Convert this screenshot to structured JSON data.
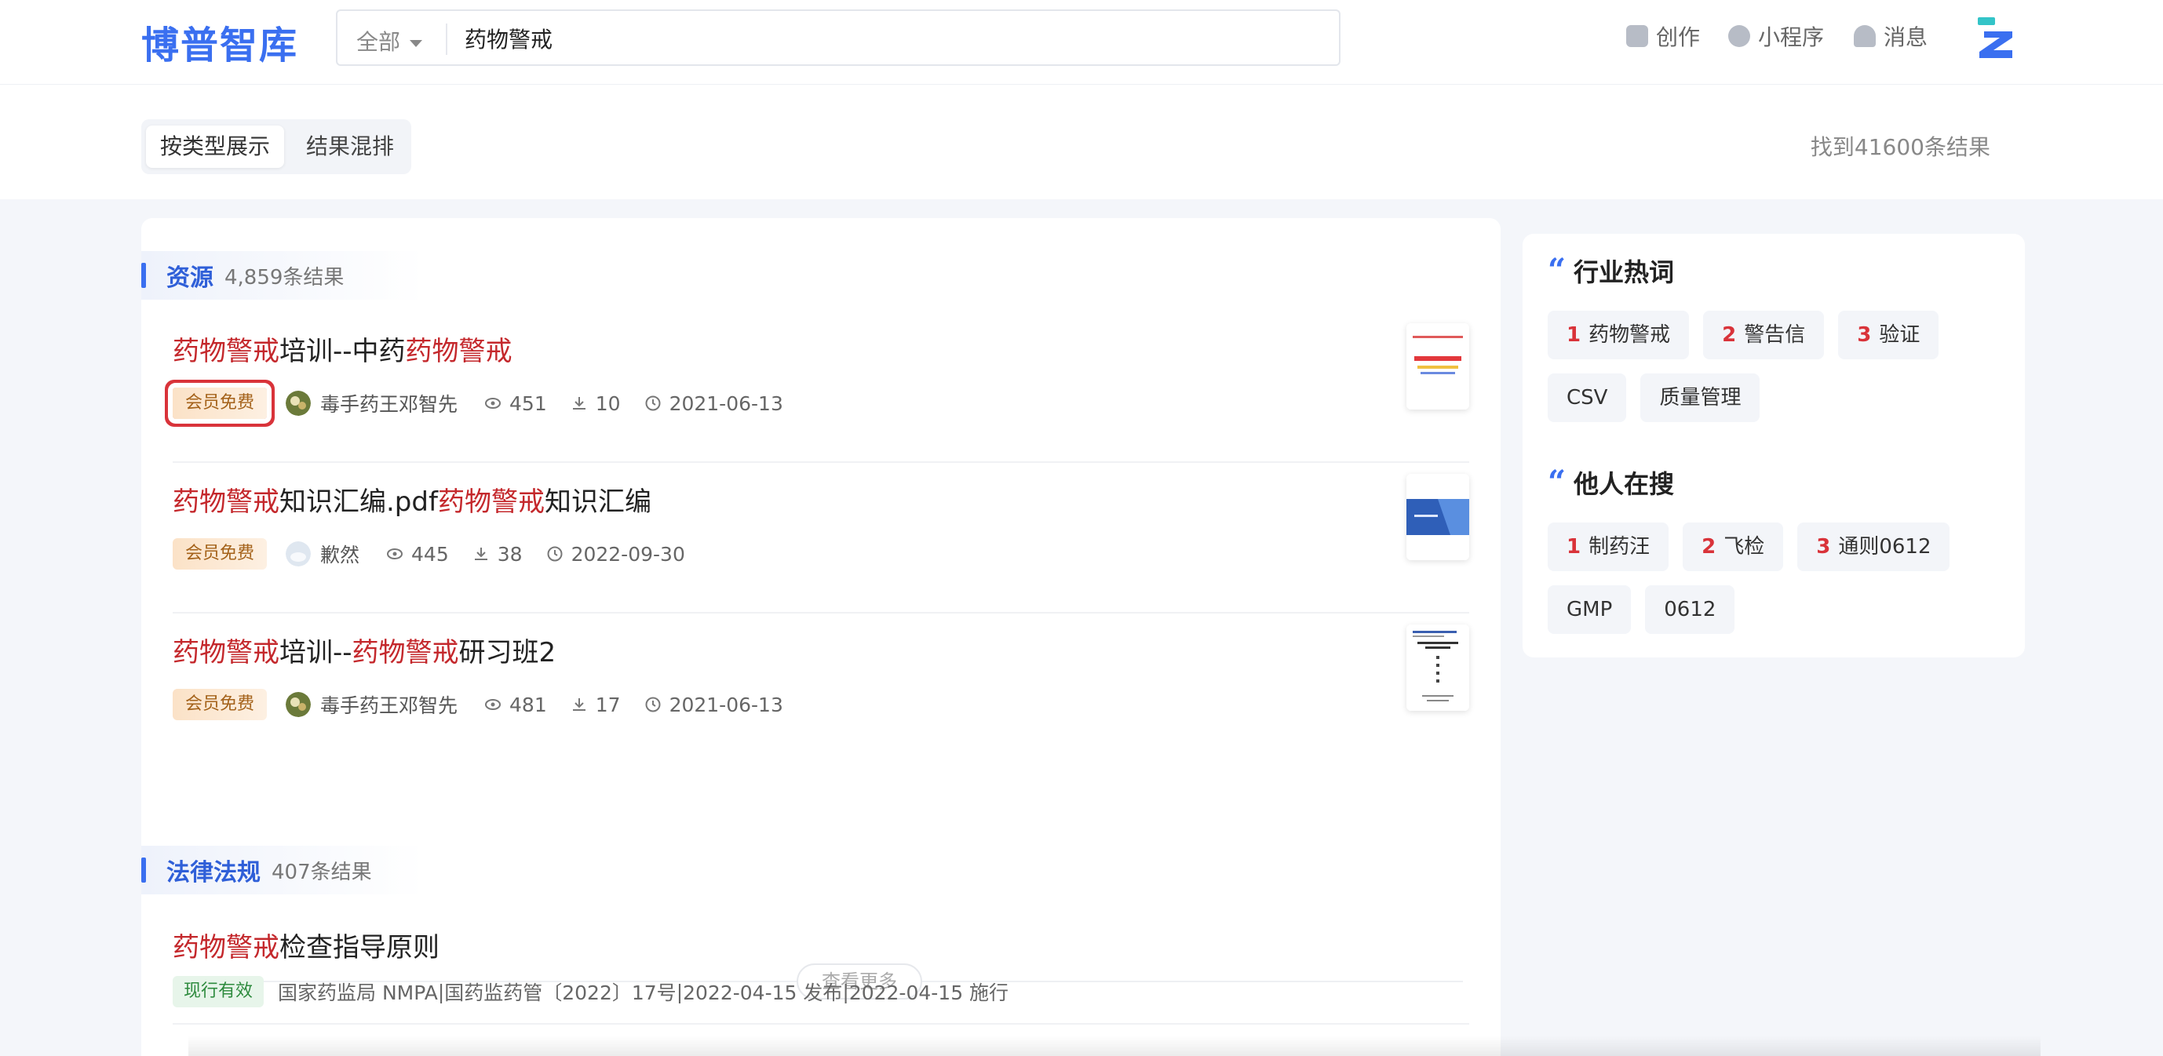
{
  "header": {
    "logo": "博普智库",
    "search_scope": "全部",
    "search_query": "药物警戒",
    "nav": [
      {
        "label": "创作",
        "icon": "edit-icon"
      },
      {
        "label": "小程序",
        "icon": "miniprogram-icon"
      },
      {
        "label": "消息",
        "icon": "bell-icon"
      }
    ]
  },
  "subbar": {
    "toggle_by_type": "按类型展示",
    "toggle_mixed": "结果混排",
    "total": "找到41600条结果"
  },
  "resources": {
    "title": "资源",
    "count": "4,859条结果",
    "items": [
      {
        "t": [
          "药物警戒",
          "培训--中药",
          "药物警戒"
        ],
        "badge": "会员免费",
        "author": "毒手药王邓智先",
        "views": "451",
        "downloads": "10",
        "date": "2021-06-13"
      },
      {
        "t": [
          "药物警戒",
          "知识汇编.pdf",
          "药物警戒",
          "知识汇编"
        ],
        "badge": "会员免费",
        "author": "歉然",
        "views": "445",
        "downloads": "38",
        "date": "2022-09-30"
      },
      {
        "t": [
          "药物警戒",
          "培训--",
          "药物警戒",
          "研习班2"
        ],
        "badge": "会员免费",
        "author": "毒手药王邓智先",
        "views": "481",
        "downloads": "17",
        "date": "2021-06-13"
      }
    ],
    "more": "查看更多"
  },
  "laws": {
    "title": "法律法规",
    "count": "407条结果",
    "item": {
      "t": [
        "药物警戒",
        "检查指导原则"
      ],
      "badge": "现行有效",
      "agency": "国家药监局 NMPA",
      "doc_no": "国药监药管〔2022〕17号",
      "publish": "2022-04-15 发布",
      "effective": "2022-04-15 施行"
    }
  },
  "side": {
    "hot_title": "行业热词",
    "hot_tags": [
      {
        "rank": "1",
        "label": "药物警戒"
      },
      {
        "rank": "2",
        "label": "警告信"
      },
      {
        "rank": "3",
        "label": "验证"
      },
      {
        "rank": "",
        "label": "CSV"
      },
      {
        "rank": "",
        "label": "质量管理"
      }
    ],
    "others_title": "他人在搜",
    "others_tags": [
      {
        "rank": "1",
        "label": "制药汪"
      },
      {
        "rank": "2",
        "label": "飞检"
      },
      {
        "rank": "3",
        "label": "通则0612"
      },
      {
        "rank": "",
        "label": "GMP"
      },
      {
        "rank": "",
        "label": "0612"
      }
    ]
  },
  "colors": {
    "brand": "#3a6ff0",
    "highlight": "#c4282c",
    "badge_free": "#a4621a",
    "badge_valid": "#2e8b3e"
  }
}
